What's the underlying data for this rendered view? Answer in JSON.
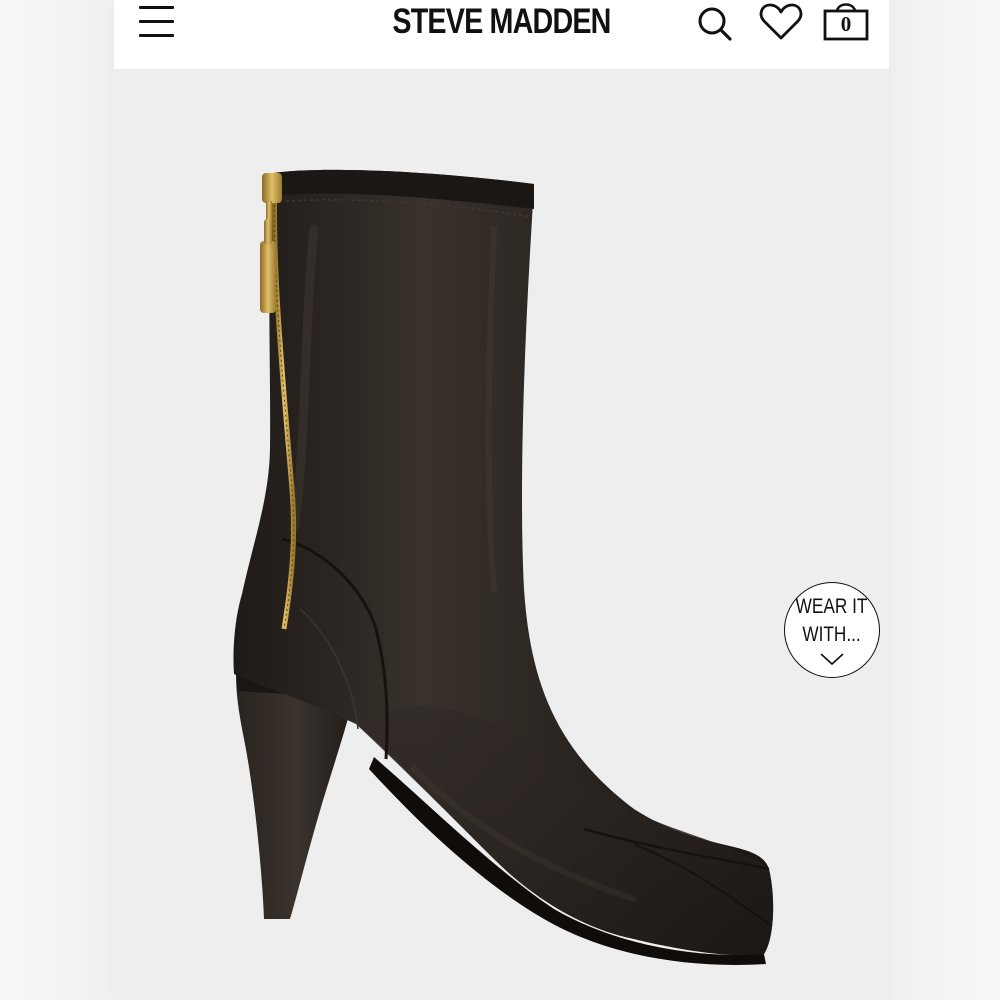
{
  "header": {
    "brand": "STEVE MADDEN",
    "menu_icon": "hamburger-menu-icon",
    "search_icon": "search-icon",
    "wishlist_icon": "heart-icon",
    "cart_icon": "shopping-bag-icon",
    "cart_count": "0"
  },
  "product": {
    "image_icon": "black-heeled-ankle-boot-image",
    "color": "#2a2521",
    "zipper_color": "#c9a24a"
  },
  "wear_it_with": {
    "line1": "WEAR IT",
    "line2": "WITH...",
    "arrow_icon": "chevron-down-icon"
  },
  "colors": {
    "background": "#eeeeee",
    "header_bg": "#ffffff",
    "text": "#111111"
  }
}
